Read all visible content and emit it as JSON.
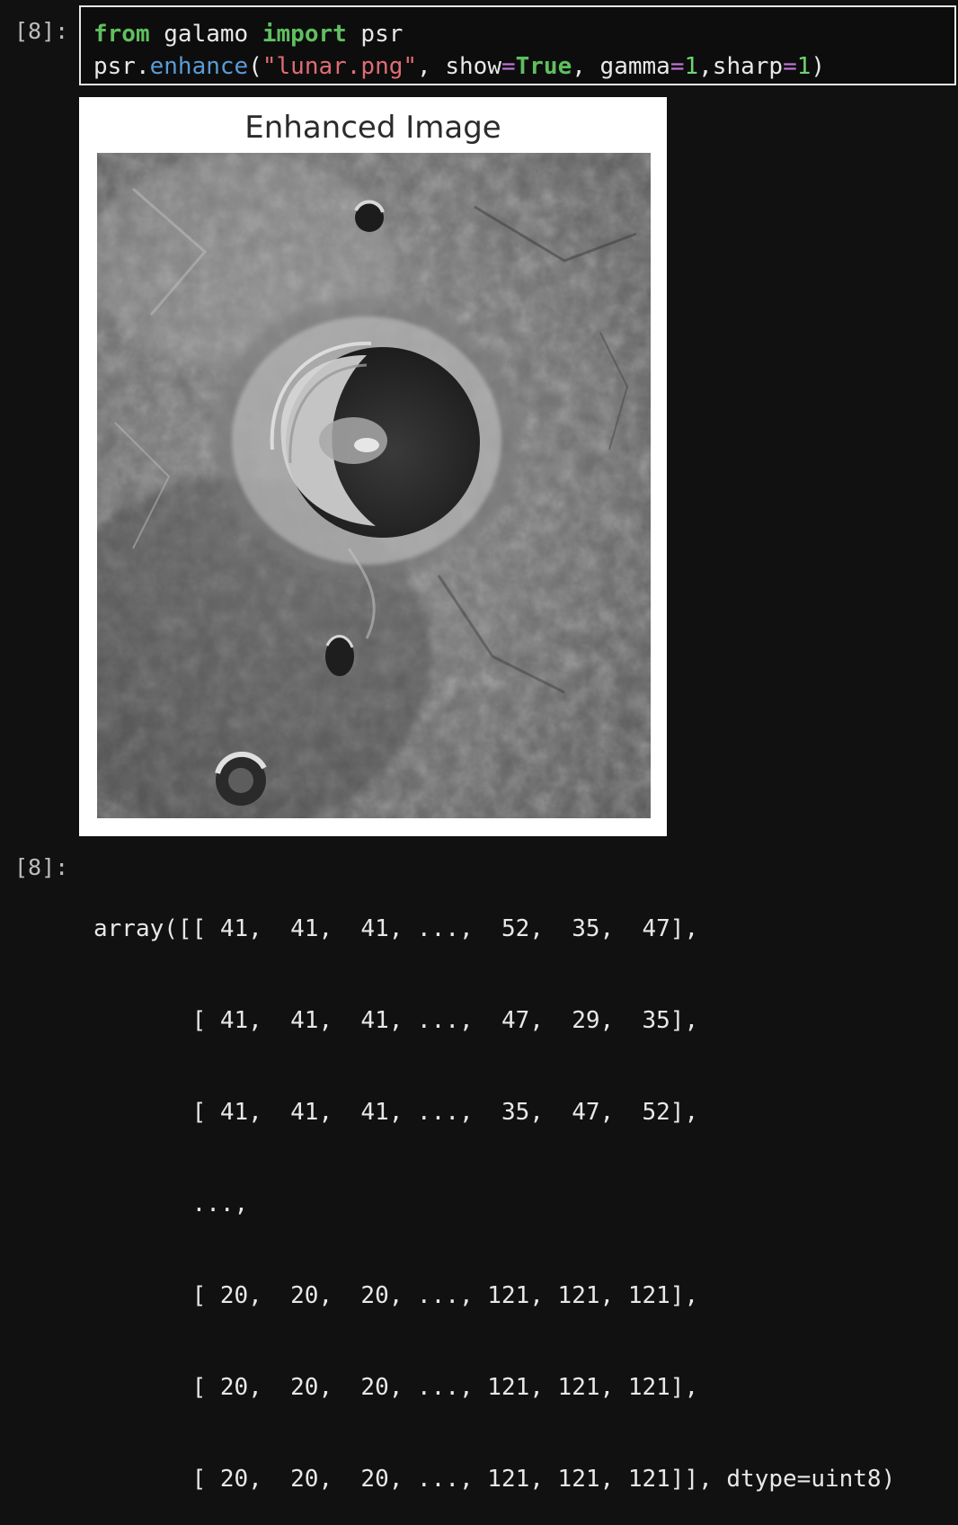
{
  "input_prompt": "[8]:",
  "output_prompt": "[8]:",
  "code": {
    "line1": {
      "kw_from": "from",
      "module": " galamo ",
      "kw_import": "import",
      "name": " psr"
    },
    "line2": {
      "obj": "psr.",
      "func": "enhance",
      "open": "(",
      "arg_str": "\"lunar.png\"",
      "sep1": ", show",
      "eq1": "=",
      "true_kw": "True",
      "sep2": ", gamma",
      "eq2": "=",
      "val1": "1",
      "sep3": ",sharp",
      "eq3": "=",
      "val2": "1",
      "close": ")"
    }
  },
  "figure": {
    "title": "Enhanced Image",
    "image_subject": "grayscale lunar crater surface"
  },
  "output_lines": [
    "array([[ 41,  41,  41, ...,  52,  35,  47],",
    "       [ 41,  41,  41, ...,  47,  29,  35],",
    "       [ 41,  41,  41, ...,  35,  47,  52],",
    "       ...,",
    "       [ 20,  20,  20, ..., 121, 121, 121],",
    "       [ 20,  20,  20, ..., 121, 121, 121],",
    "       [ 20,  20,  20, ..., 121, 121, 121]], dtype=uint8)"
  ]
}
